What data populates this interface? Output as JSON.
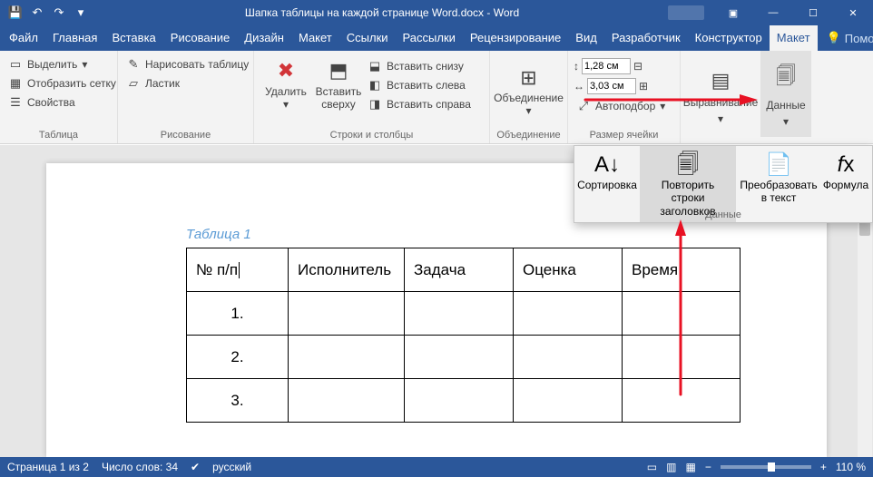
{
  "titlebar": {
    "title": "Шапка таблицы на каждой странице Word.docx  -  Word"
  },
  "menu": {
    "file": "Файл",
    "home": "Главная",
    "insert": "Вставка",
    "draw": "Рисование",
    "design": "Дизайн",
    "layout": "Макет",
    "refs": "Ссылки",
    "mail": "Рассылки",
    "review": "Рецензирование",
    "view": "Вид",
    "dev": "Разработчик",
    "constructor": "Конструктор",
    "layout2": "Макет",
    "help": "Помощь"
  },
  "ribbon": {
    "table_group": "Таблица",
    "select": "Выделить",
    "grid": "Отобразить сетку",
    "props": "Свойства",
    "draw_group": "Рисование",
    "draw_table": "Нарисовать таблицу",
    "eraser": "Ластик",
    "rowscols_group": "Строки и столбцы",
    "delete": "Удалить",
    "ins_above": "Вставить сверху",
    "ins_below": "Вставить снизу",
    "ins_left": "Вставить слева",
    "ins_right": "Вставить справа",
    "merge_group": "Объединение",
    "merge": "Объединение",
    "cellsize_group": "Размер ячейки",
    "height": "1,28 см",
    "width": "3,03 см",
    "autofit": "Автоподбор",
    "align": "Выравнивание",
    "data": "Данные"
  },
  "dropdown": {
    "sort": "Сортировка",
    "repeat": "Повторить строки заголовков",
    "convert": "Преобразовать в текст",
    "formula": "Формула",
    "label": "Данные"
  },
  "doc": {
    "caption": "Таблица 1",
    "headers": [
      "№ п/п",
      "Исполнитель",
      "Задача",
      "Оценка",
      "Время"
    ],
    "rows": [
      "1.",
      "2.",
      "3."
    ]
  },
  "status": {
    "page": "Страница 1 из 2",
    "words": "Число слов: 34",
    "lang": "русский",
    "zoom": "110 %"
  }
}
